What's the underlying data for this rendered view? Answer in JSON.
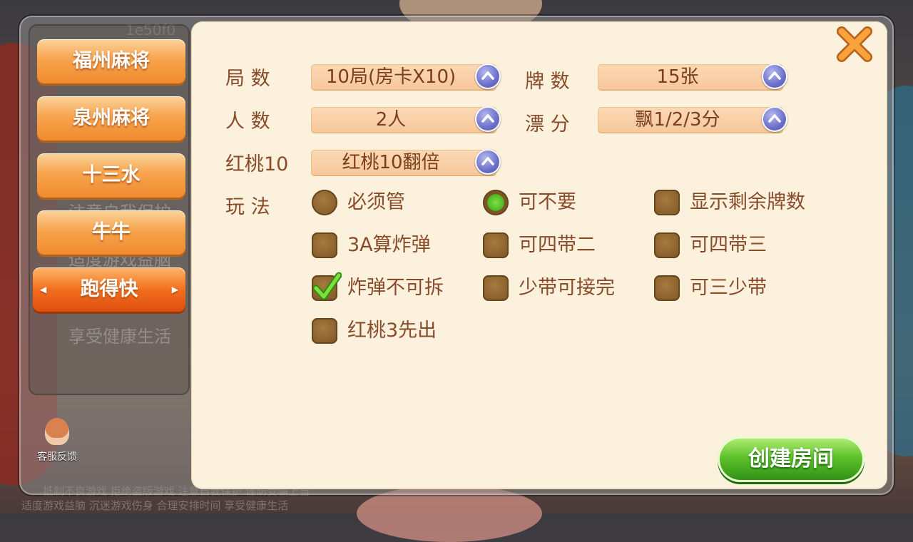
{
  "background": {
    "room_id_partial": "1e50f0",
    "sidebar_scroll_text": [
      "注意自我保护",
      "适度游戏益脑",
      "享受健康生活"
    ],
    "bottom_notice_line1": "抵制不良游戏 拒绝盗版游戏 注意自我保护 谨防受骗上当",
    "bottom_notice_line2": "适度游戏益脑 沉迷游戏伤身 合理安排时间 享受健康生活"
  },
  "tabs": [
    {
      "label": "福州麻将",
      "active": false
    },
    {
      "label": "泉州麻将",
      "active": false
    },
    {
      "label": "十三水",
      "active": false
    },
    {
      "label": "牛牛",
      "active": false
    },
    {
      "label": "跑得快",
      "active": true
    }
  ],
  "service": {
    "label": "客服反馈"
  },
  "settings": {
    "rounds": {
      "label": "局 数",
      "value": "10局(房卡X10)"
    },
    "cards": {
      "label": "牌 数",
      "value": "15张"
    },
    "players": {
      "label": "人 数",
      "value": "2人"
    },
    "float_score": {
      "label": "漂 分",
      "value": "飘1/2/3分"
    },
    "heart10": {
      "label": "红桃10",
      "value": "红桃10翻倍"
    },
    "rules_label": "玩 法"
  },
  "rules": {
    "must_play": {
      "label": "必须管",
      "checked": false
    },
    "can_pass": {
      "label": "可不要",
      "checked": true
    },
    "show_remaining": {
      "label": "显示剩余牌数",
      "checked": false
    },
    "three_a_bomb": {
      "label": "3A算炸弹",
      "checked": false
    },
    "four_with_two": {
      "label": "可四带二",
      "checked": false
    },
    "four_with_three": {
      "label": "可四带三",
      "checked": false
    },
    "bomb_unsplittable": {
      "label": "炸弹不可拆",
      "checked": true
    },
    "short_finish": {
      "label": "少带可接完",
      "checked": false
    },
    "three_short": {
      "label": "可三少带",
      "checked": false
    },
    "heart3_first": {
      "label": "红桃3先出",
      "checked": false
    }
  },
  "create_button": {
    "label": "创建房间"
  },
  "colors": {
    "panel": "#fcf1dc",
    "text": "#8a4b2a",
    "tab_orange": "#f7a44d",
    "active_tab": "#de4e0f",
    "create_green": "#5ec22c"
  }
}
